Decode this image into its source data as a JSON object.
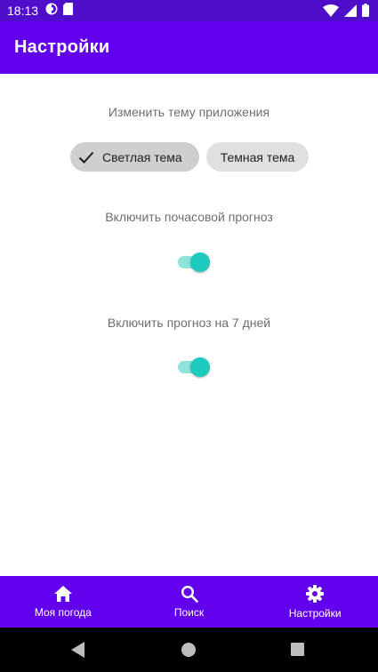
{
  "status_bar": {
    "time": "18:13",
    "left_icons": [
      "circle-app-icon",
      "sd-card-icon"
    ],
    "right_icons": [
      "wifi-icon",
      "cellular-signal-icon",
      "battery-icon"
    ]
  },
  "app_bar": {
    "title": "Настройки"
  },
  "theme_section": {
    "label": "Изменить тему приложения",
    "chips": [
      {
        "label": "Светлая тема",
        "selected": true,
        "icon": "check-icon"
      },
      {
        "label": "Темная тема",
        "selected": false
      }
    ]
  },
  "hourly_section": {
    "label": "Включить почасовой прогноз",
    "enabled": true
  },
  "weekly_section": {
    "label": "Включить прогноз на 7 дней",
    "enabled": true
  },
  "bottom_nav": {
    "items": [
      {
        "label": "Моя погода",
        "icon": "home-icon"
      },
      {
        "label": "Поиск",
        "icon": "search-icon"
      },
      {
        "label": "Настройки",
        "icon": "gear-icon"
      }
    ]
  },
  "colors": {
    "status_bar": "#4f0ec9",
    "primary": "#6200ee",
    "switch_thumb": "#1ccbbd",
    "switch_track": "#8fe3d9"
  }
}
